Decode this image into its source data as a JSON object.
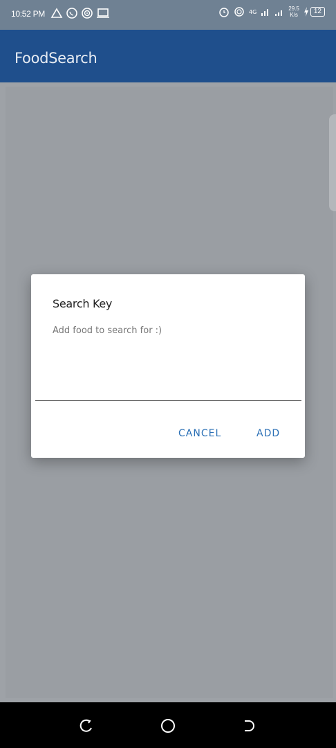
{
  "status_bar": {
    "time": "10:52 PM",
    "network_speed_value": "29.5",
    "network_speed_unit": "K/s",
    "network_type": "4G",
    "battery_level": "12",
    "left_icons": [
      "warning-icon",
      "whatsapp-icon",
      "hotspot-icon",
      "laptop-icon"
    ],
    "right_icons": [
      "alarm-icon",
      "hotspot-icon",
      "signal-icon",
      "signal-icon",
      "charging-icon",
      "battery-icon"
    ]
  },
  "app_bar": {
    "title": "FoodSearch",
    "color": "#1f4f8c"
  },
  "dialog": {
    "title": "Search Key",
    "input_placeholder": "Add food to search for :)",
    "input_value": "",
    "cancel_label": "CANCEL",
    "add_label": "ADD",
    "accent_color": "#2a6fb5"
  },
  "nav_bar": {
    "buttons": [
      "back-icon",
      "home-icon",
      "recents-icon"
    ]
  }
}
